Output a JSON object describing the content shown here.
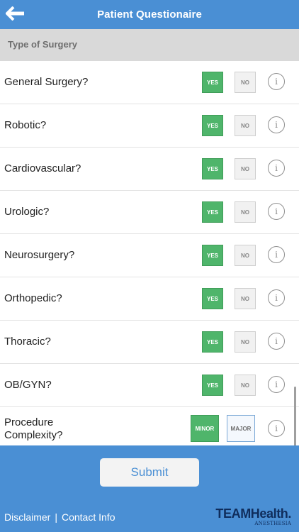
{
  "header": {
    "title": "Patient Questionaire",
    "back_icon": "back-arrow-icon"
  },
  "section": {
    "label": "Type of Surgery"
  },
  "questions": [
    {
      "label": "General Surgery?",
      "yes": "YES",
      "no": "NO",
      "selected": "yes"
    },
    {
      "label": "Robotic?",
      "yes": "YES",
      "no": "NO",
      "selected": "yes"
    },
    {
      "label": "Cardiovascular?",
      "yes": "YES",
      "no": "NO",
      "selected": "yes"
    },
    {
      "label": "Urologic?",
      "yes": "YES",
      "no": "NO",
      "selected": "yes"
    },
    {
      "label": "Neurosurgery?",
      "yes": "YES",
      "no": "NO",
      "selected": "yes"
    },
    {
      "label": "Orthopedic?",
      "yes": "YES",
      "no": "NO",
      "selected": "yes"
    },
    {
      "label": "Thoracic?",
      "yes": "YES",
      "no": "NO",
      "selected": "yes"
    },
    {
      "label": "OB/GYN?",
      "yes": "YES",
      "no": "NO",
      "selected": "yes"
    }
  ],
  "complexity": {
    "label_line1": "Procedure",
    "label_line2": "Complexity?",
    "minor": "MINOR",
    "major": "MAJOR",
    "selected": "minor"
  },
  "info_icon_glyph": "i",
  "footer": {
    "submit_label": "Submit",
    "disclaimer_label": "Disclaimer",
    "separator": "|",
    "contact_label": "Contact Info",
    "logo_main": "TEAMHealth.",
    "logo_sub": "ANESTHESIA"
  },
  "colors": {
    "header_bg": "#4a8fd4",
    "selected_green": "#4fb56b",
    "unselected_gray": "#f1f1f1",
    "logo_navy": "#0f2d5c"
  }
}
